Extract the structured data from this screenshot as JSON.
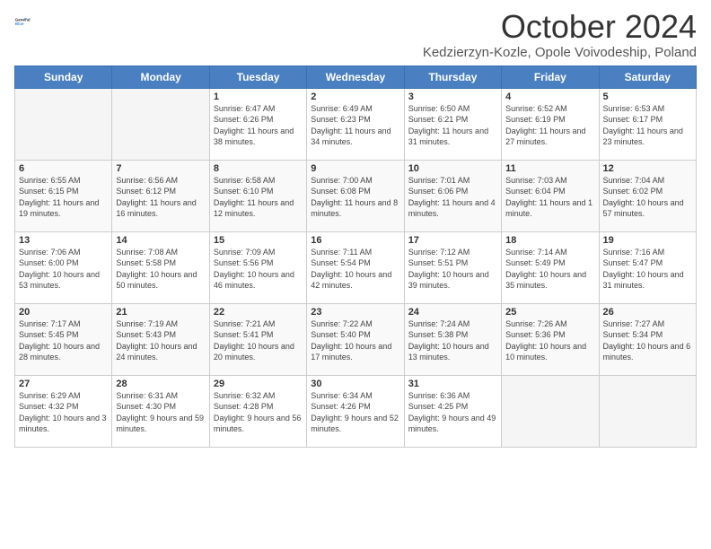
{
  "header": {
    "logo_line1": "General",
    "logo_line2": "Blue",
    "month_title": "October 2024",
    "location": "Kedzierzyn-Kozle, Opole Voivodeship, Poland"
  },
  "days_of_week": [
    "Sunday",
    "Monday",
    "Tuesday",
    "Wednesday",
    "Thursday",
    "Friday",
    "Saturday"
  ],
  "weeks": [
    [
      {
        "num": "",
        "info": ""
      },
      {
        "num": "",
        "info": ""
      },
      {
        "num": "1",
        "info": "Sunrise: 6:47 AM\nSunset: 6:26 PM\nDaylight: 11 hours and 38 minutes."
      },
      {
        "num": "2",
        "info": "Sunrise: 6:49 AM\nSunset: 6:23 PM\nDaylight: 11 hours and 34 minutes."
      },
      {
        "num": "3",
        "info": "Sunrise: 6:50 AM\nSunset: 6:21 PM\nDaylight: 11 hours and 31 minutes."
      },
      {
        "num": "4",
        "info": "Sunrise: 6:52 AM\nSunset: 6:19 PM\nDaylight: 11 hours and 27 minutes."
      },
      {
        "num": "5",
        "info": "Sunrise: 6:53 AM\nSunset: 6:17 PM\nDaylight: 11 hours and 23 minutes."
      }
    ],
    [
      {
        "num": "6",
        "info": "Sunrise: 6:55 AM\nSunset: 6:15 PM\nDaylight: 11 hours and 19 minutes."
      },
      {
        "num": "7",
        "info": "Sunrise: 6:56 AM\nSunset: 6:12 PM\nDaylight: 11 hours and 16 minutes."
      },
      {
        "num": "8",
        "info": "Sunrise: 6:58 AM\nSunset: 6:10 PM\nDaylight: 11 hours and 12 minutes."
      },
      {
        "num": "9",
        "info": "Sunrise: 7:00 AM\nSunset: 6:08 PM\nDaylight: 11 hours and 8 minutes."
      },
      {
        "num": "10",
        "info": "Sunrise: 7:01 AM\nSunset: 6:06 PM\nDaylight: 11 hours and 4 minutes."
      },
      {
        "num": "11",
        "info": "Sunrise: 7:03 AM\nSunset: 6:04 PM\nDaylight: 11 hours and 1 minute."
      },
      {
        "num": "12",
        "info": "Sunrise: 7:04 AM\nSunset: 6:02 PM\nDaylight: 10 hours and 57 minutes."
      }
    ],
    [
      {
        "num": "13",
        "info": "Sunrise: 7:06 AM\nSunset: 6:00 PM\nDaylight: 10 hours and 53 minutes."
      },
      {
        "num": "14",
        "info": "Sunrise: 7:08 AM\nSunset: 5:58 PM\nDaylight: 10 hours and 50 minutes."
      },
      {
        "num": "15",
        "info": "Sunrise: 7:09 AM\nSunset: 5:56 PM\nDaylight: 10 hours and 46 minutes."
      },
      {
        "num": "16",
        "info": "Sunrise: 7:11 AM\nSunset: 5:54 PM\nDaylight: 10 hours and 42 minutes."
      },
      {
        "num": "17",
        "info": "Sunrise: 7:12 AM\nSunset: 5:51 PM\nDaylight: 10 hours and 39 minutes."
      },
      {
        "num": "18",
        "info": "Sunrise: 7:14 AM\nSunset: 5:49 PM\nDaylight: 10 hours and 35 minutes."
      },
      {
        "num": "19",
        "info": "Sunrise: 7:16 AM\nSunset: 5:47 PM\nDaylight: 10 hours and 31 minutes."
      }
    ],
    [
      {
        "num": "20",
        "info": "Sunrise: 7:17 AM\nSunset: 5:45 PM\nDaylight: 10 hours and 28 minutes."
      },
      {
        "num": "21",
        "info": "Sunrise: 7:19 AM\nSunset: 5:43 PM\nDaylight: 10 hours and 24 minutes."
      },
      {
        "num": "22",
        "info": "Sunrise: 7:21 AM\nSunset: 5:41 PM\nDaylight: 10 hours and 20 minutes."
      },
      {
        "num": "23",
        "info": "Sunrise: 7:22 AM\nSunset: 5:40 PM\nDaylight: 10 hours and 17 minutes."
      },
      {
        "num": "24",
        "info": "Sunrise: 7:24 AM\nSunset: 5:38 PM\nDaylight: 10 hours and 13 minutes."
      },
      {
        "num": "25",
        "info": "Sunrise: 7:26 AM\nSunset: 5:36 PM\nDaylight: 10 hours and 10 minutes."
      },
      {
        "num": "26",
        "info": "Sunrise: 7:27 AM\nSunset: 5:34 PM\nDaylight: 10 hours and 6 minutes."
      }
    ],
    [
      {
        "num": "27",
        "info": "Sunrise: 6:29 AM\nSunset: 4:32 PM\nDaylight: 10 hours and 3 minutes."
      },
      {
        "num": "28",
        "info": "Sunrise: 6:31 AM\nSunset: 4:30 PM\nDaylight: 9 hours and 59 minutes."
      },
      {
        "num": "29",
        "info": "Sunrise: 6:32 AM\nSunset: 4:28 PM\nDaylight: 9 hours and 56 minutes."
      },
      {
        "num": "30",
        "info": "Sunrise: 6:34 AM\nSunset: 4:26 PM\nDaylight: 9 hours and 52 minutes."
      },
      {
        "num": "31",
        "info": "Sunrise: 6:36 AM\nSunset: 4:25 PM\nDaylight: 9 hours and 49 minutes."
      },
      {
        "num": "",
        "info": ""
      },
      {
        "num": "",
        "info": ""
      }
    ]
  ]
}
